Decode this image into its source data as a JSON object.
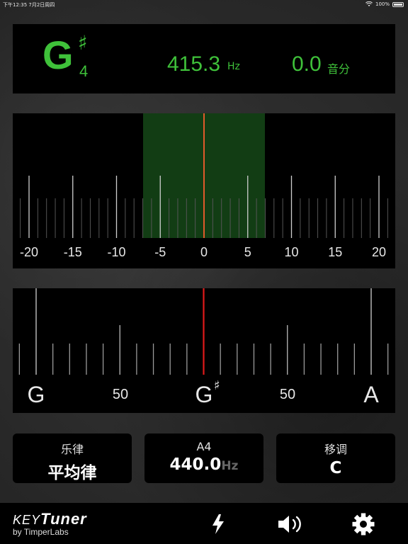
{
  "status_bar": {
    "time_date": "下午12:35   7月2日周四",
    "battery": "100%"
  },
  "display": {
    "note": "G",
    "accidental": "♯",
    "octave": "4",
    "frequency": "415.3",
    "frequency_unit": "Hz",
    "cents": "0.0",
    "cents_unit": "音分",
    "accent_color": "#3fc13a"
  },
  "fine_meter": {
    "tick_labels": [
      "-20",
      "-15",
      "-10",
      "-5",
      "0",
      "5",
      "10",
      "15",
      "20"
    ],
    "in_tune_zone": [
      -7,
      7
    ],
    "needle_value": 0,
    "needle_color": "#e05a2a",
    "zone_color": "#123d14"
  },
  "coarse_meter": {
    "left_note": "G",
    "center_note": "G",
    "center_accidental": "♯",
    "right_note": "A",
    "left_cents": "50",
    "right_cents": "50",
    "needle_value": 0,
    "needle_color": "#e11a1a"
  },
  "cards": {
    "temperament": {
      "heading": "乐律",
      "value": "平均律"
    },
    "reference": {
      "heading": "A4",
      "value": "440.0",
      "unit": "Hz"
    },
    "transpose": {
      "heading": "移调",
      "value": "C"
    }
  },
  "bottom_bar": {
    "brand_key": "KEY",
    "brand_tuner": "Tuner",
    "brand_by": "by TimperLabs",
    "icons": [
      "flash-icon",
      "speaker-icon",
      "gear-icon"
    ]
  }
}
